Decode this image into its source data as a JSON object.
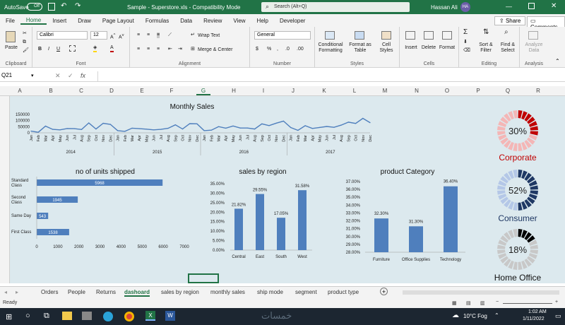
{
  "titlebar": {
    "autosave_label": "AutoSave",
    "autosave_state": "Off",
    "doc_title": "Sample - Superstore.xls - Compatibility Mode",
    "search_placeholder": "Search (Alt+Q)",
    "user_name": "Hassan Ali",
    "user_initials": "HA"
  },
  "menu": {
    "items": [
      "File",
      "Home",
      "Insert",
      "Draw",
      "Page Layout",
      "Formulas",
      "Data",
      "Review",
      "View",
      "Help",
      "Developer"
    ],
    "active": "Home",
    "share_label": "Share",
    "comments_label": "Comments"
  },
  "ribbon": {
    "clipboard": {
      "paste": "Paste",
      "label": "Clipboard"
    },
    "font": {
      "name": "Calibri",
      "size": "12",
      "label": "Font"
    },
    "alignment": {
      "wrap": "Wrap Text",
      "merge": "Merge & Center",
      "label": "Alignment"
    },
    "number": {
      "format": "General",
      "label": "Number"
    },
    "styles": {
      "conditional": "Conditional Formatting",
      "format_table": "Format as Table",
      "cell_styles": "Cell Styles",
      "label": "Styles"
    },
    "cells": {
      "insert": "Insert",
      "delete": "Delete",
      "format": "Format",
      "label": "Cells"
    },
    "editing": {
      "sort": "Sort & Filter",
      "find": "Find & Select",
      "label": "Editing"
    },
    "analysis": {
      "analyze": "Analyze Data",
      "label": "Analysis"
    }
  },
  "formula_bar": {
    "name_box": "Q21",
    "fx": "fx",
    "value": ""
  },
  "columns": [
    "A",
    "B",
    "C",
    "D",
    "E",
    "F",
    "G",
    "H",
    "I",
    "J",
    "K",
    "L",
    "M",
    "N",
    "O",
    "P",
    "Q",
    "R"
  ],
  "selected_column": "G",
  "sheet_tabs": [
    "Orders",
    "People",
    "Returns",
    "dashoard",
    "sales by region",
    "monthly sales",
    "ship mode",
    "segment",
    "product type"
  ],
  "active_tab": "dashoard",
  "status": {
    "ready": "Ready"
  },
  "taskbar": {
    "weather": "10°C Fog",
    "time": "1:02 AM",
    "date": "1/11/2022",
    "watermark": "خمسات"
  },
  "chart_data": [
    {
      "type": "line",
      "title": "Monthly Sales",
      "ylim": [
        0,
        150000
      ],
      "yticks": [
        "150000",
        "100000",
        "50000",
        "0"
      ],
      "years": [
        "2014",
        "2015",
        "2016",
        "2017"
      ],
      "x": [
        "Jan",
        "Feb",
        "Mar",
        "Apr",
        "May",
        "Jun",
        "Jul",
        "Aug",
        "Sep",
        "Oct",
        "Nov",
        "Dec",
        "Jan",
        "Feb",
        "Mar",
        "Apr",
        "May",
        "Jun",
        "Jul",
        "Aug",
        "Sep",
        "Oct",
        "Nov",
        "Dec",
        "Jan",
        "Feb",
        "Mar",
        "Apr",
        "May",
        "Jun",
        "Jul",
        "Aug",
        "Sep",
        "Oct",
        "Nov",
        "Dec",
        "Jan",
        "Feb",
        "Mar",
        "Apr",
        "May",
        "Jun",
        "Jul",
        "Aug",
        "Sep",
        "Oct",
        "Nov",
        "Dec"
      ],
      "values": [
        14000,
        4500,
        55000,
        28000,
        24000,
        35000,
        34000,
        27000,
        81000,
        31000,
        78000,
        69000,
        18000,
        12000,
        38000,
        34000,
        30000,
        24000,
        28000,
        37000,
        65000,
        31000,
        75000,
        74000,
        18000,
        22000,
        51000,
        38000,
        56000,
        39000,
        39000,
        31000,
        73000,
        59000,
        79000,
        96000,
        43000,
        20000,
        58000,
        36000,
        44000,
        52000,
        45000,
        63000,
        87000,
        77000,
        118000,
        83000
      ]
    },
    {
      "type": "bar",
      "title": "no of units shipped",
      "orientation": "horizontal",
      "categories": [
        "Standard Class",
        "Second Class",
        "Same Day",
        "First Class"
      ],
      "values": [
        5968,
        1945,
        543,
        1538
      ],
      "xlim": [
        0,
        7000
      ],
      "xticks": [
        "0",
        "1000",
        "2000",
        "3000",
        "4000",
        "5000",
        "6000",
        "7000"
      ]
    },
    {
      "type": "bar",
      "title": "sales by region",
      "categories": [
        "Central",
        "East",
        "South",
        "West"
      ],
      "values": [
        21.82,
        29.55,
        17.05,
        31.58
      ],
      "labels": [
        "21.82%",
        "29.55%",
        "17.05%",
        "31.58%"
      ],
      "ylim": [
        0,
        35
      ],
      "yticks": [
        "35.00%",
        "30.00%",
        "25.00%",
        "20.00%",
        "15.00%",
        "10.00%",
        "5.00%",
        "0.00%"
      ]
    },
    {
      "type": "bar",
      "title": "product Category",
      "categories": [
        "Furniture",
        "Office Supplies",
        "Technology"
      ],
      "values": [
        32.3,
        31.3,
        36.4
      ],
      "labels": [
        "32.30%",
        "31.30%",
        "36.40%"
      ],
      "ylim": [
        28,
        37
      ],
      "yticks": [
        "37.00%",
        "36.00%",
        "35.00%",
        "34.00%",
        "33.00%",
        "32.00%",
        "31.00%",
        "30.00%",
        "29.00%",
        "28.00%"
      ]
    },
    {
      "type": "pie",
      "title": "Corporate",
      "value": 30,
      "label": "30%",
      "color": "#c00000"
    },
    {
      "type": "pie",
      "title": "Consumer",
      "value": 52,
      "label": "52%",
      "color": "#1f3864"
    },
    {
      "type": "pie",
      "title": "Home Office",
      "value": 18,
      "label": "18%",
      "color": "#000000"
    }
  ]
}
